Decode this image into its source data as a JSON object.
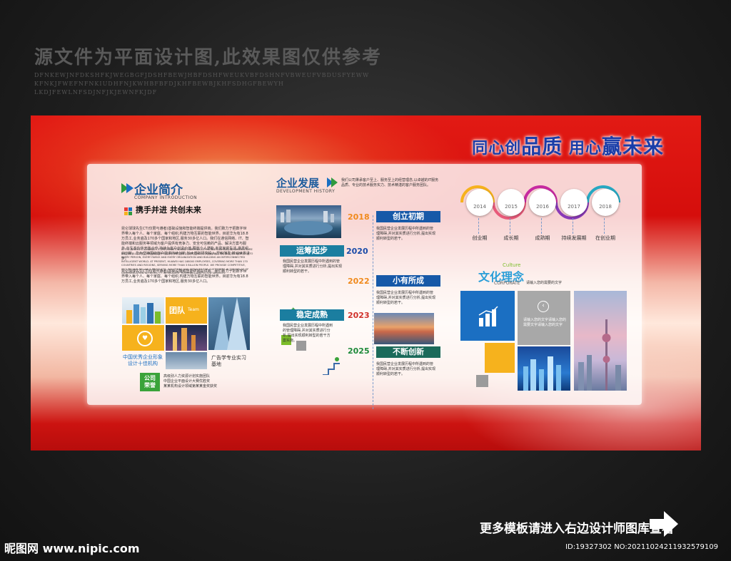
{
  "watermark": {
    "title": "源文件为平面设计图,此效果图仅供参考",
    "letters": "DFNKEWJNFDKSHFKJWEGBGFJDSHFBEWJHBFDSHFWEUKVBFDSHNFVBWEUFVBDUSFYEWW KFNKJFWEFNFNKIUDHFNJKWHBFBFDJKHFBEWBJKHFSDHGFBEWYH LKDJFEWLNFSDJNFJKJEWNFKJDF"
  },
  "banner": {
    "slogan_a": "同心创",
    "slogan_b": "品质",
    "slogan_c": "用心",
    "slogan_d": "赢未来"
  },
  "intro": {
    "title": "企业简介",
    "subtitle": "COMPANY INTRODUCTION",
    "motto": "携手并进 共创未来",
    "para1": "昆仑球球先生CT(仅限与遵者)基础设施和智能终端提供商。我们致力于把数字世界带入每个人、每个家庭、每个组织,构建万物互联的智能世界。目前华为有18.8万员工,业务遍及170多个国家和地区,服务30多亿人口。我们在通信网络、IT、智能终端和云服务等领域为客户提供有竞争力、安全可信赖的产品、解决方案与服务,与生态伙伴开放合作,持续为客户创造价值,释放个人潜能,丰富家庭生活,激发组织创新。华为坚持围绕客户需求持续创新,加大基础研究投入,厚积薄发,推动世界进步。",
    "para2": "IS THE WORLD'S LEADING ICT (INFORMATION AND COMMUNICATION TECHNOLOGY) INFRASTRUCTURE AND INTELLIGENT TERMINAL PROVIDER. WE ARE COMMITTED TO BRINGING THE DIGITAL WORLD INTO EVERY PERSON, EVERY FAMILY AND EVERY ORGANIZATION AND BUILDING AN INTERCONNECTED INTELLIGENT WORLD. AT PRESENT, HUAWEI HAS 188000 EMPLOYEES, COVERING MORE THAN 170 COUNTRIES AND REGIONS, SERVING MORE THAN 3 BILLION PEOPLE. WE PROVIDE COMPETITIVE, SECURE AND RELIABLE PRODUCTS, SOLUTIONS AND SERVICES FOR CUSTOMERS IN THE FIELDS OF COMMUNICATION NETWORK, IT, INTELLIGENT TERMINALS AND CLOUD SERVICES.",
    "para3": "昆仑球球先生CT(仅限与遵者)基础设施和智能终端提供商。我们致力于把数字世界带入每个人、每个家庭、每个组织,构建万物互联的智能世界。目前华为有18.8万员工,业务遍及170多个国家和地区,服务30多亿人口。",
    "team": "团队",
    "team_en": "Team",
    "award": "中国优秀企业形象设计十佳机构",
    "base": "广告学专业实习基地",
    "honor": "公司荣誉",
    "honor_lines": [
      "高级别人力资源计划实施团队",
      "中国企业平面设计大赛优胜奖",
      "某某机构设计领域第某某金奖获奖"
    ]
  },
  "dev": {
    "title": "企业发展",
    "subtitle": "DEVELOPMENT HISTORY",
    "intro": "我们公司秉承客户至上、服务至上的经营理念,以卓越的IT服务品质、专业的技术服务实力、技术精湛的客户服务团队。",
    "milestones": [
      {
        "year": "2018",
        "phase": "创立初期"
      },
      {
        "year": "2020",
        "phase": "运筹起步"
      },
      {
        "year": "2022",
        "phase": "小有所成"
      },
      {
        "year": "2023",
        "phase": "稳定成熟"
      },
      {
        "year": "2025",
        "phase": "不断创新"
      }
    ],
    "body": "我国民营企业发展历程中所遇到的管理障碍,并对其实质进行分析,提出实现顺利转型的若干。",
    "body_short": "我国民营企业发展历程中所遇到的管理障碍,并对其实质进行分析,提出实现顺利转型的若干方案实施。"
  },
  "timeline": {
    "years": [
      "2014",
      "2015",
      "2016",
      "2017",
      "2018"
    ],
    "stages": [
      "创业期",
      "成长期",
      "成熟期",
      "持续发展期",
      "在创业期"
    ]
  },
  "culture": {
    "title": "文化理念",
    "en1": "Culture",
    "en2": "CORPORATE",
    "desc": "请输入您的需要的文字",
    "tile_text": "请输入您的文字请输入您的需要文字请输入您的文字"
  },
  "colors": {
    "blue": "#1b6fc2",
    "orange": "#f6b21d",
    "green": "#7cbd2a",
    "gray": "#9b9b9b"
  },
  "footer": {
    "more": "更多模板请进入右边设计师图库查看",
    "logo": "昵图网 www.nipic.com",
    "id": "ID:19327302 NO:20211024211932579109"
  }
}
